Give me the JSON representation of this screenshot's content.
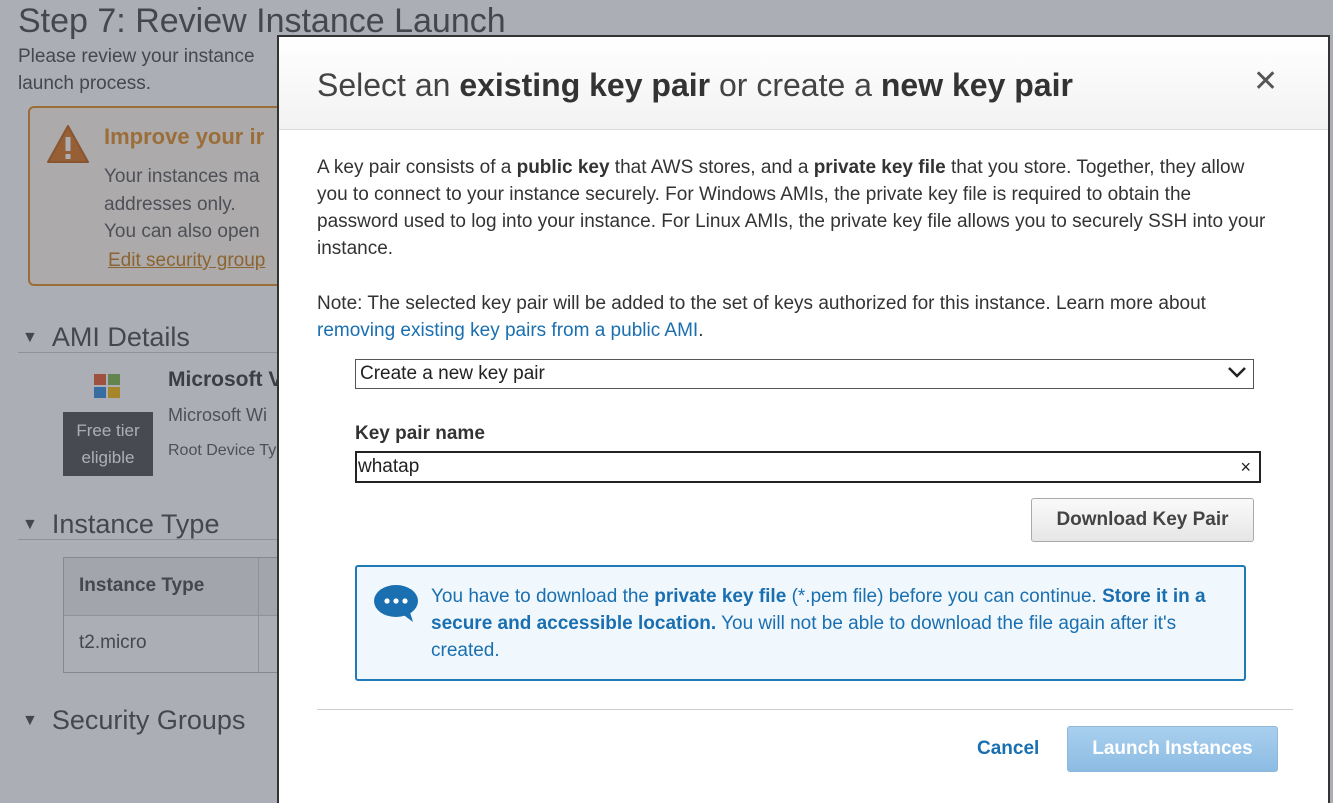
{
  "background": {
    "step_title": "Step 7: Review Instance Launch",
    "intro_line1": "Please review your instance",
    "intro_line2": "launch process.",
    "warning": {
      "title": "Improve your ir",
      "line1": "Your instances ma",
      "line2": "addresses only.",
      "line3": "You can also open",
      "link": "Edit security group"
    },
    "ami_section": "AMI Details",
    "ami": {
      "name": "Microsoft V",
      "subtitle": "Microsoft Wi",
      "root": "Root Device Ty",
      "free_tier_line1": "Free tier",
      "free_tier_line2": "eligible"
    },
    "instance_type_section": "Instance Type",
    "instance_table": {
      "header": "Instance Type",
      "value": "t2.micro"
    },
    "security_section": "Security Groups"
  },
  "modal": {
    "title_part1": "Select an ",
    "title_bold1": "existing key pair",
    "title_part2": " or create a ",
    "title_bold2": "new key pair",
    "close_glyph": "✕",
    "desc": {
      "t1": "A key pair consists of a ",
      "b1": "public key",
      "t2": " that AWS stores, and a ",
      "b2": "private key file",
      "t3": " that you store. Together, they allow you to connect to your instance securely. For Windows AMIs, the private key file is required to obtain the password used to log into your instance. For Linux AMIs, the private key file allows you to securely SSH into your instance."
    },
    "note": {
      "t1": "Note: The selected key pair will be added to the set of keys authorized for this instance. Learn more about ",
      "link": "removing existing key pairs from a public AMI",
      "t2": "."
    },
    "select_value": "Create a new key pair",
    "key_pair_label": "Key pair name",
    "key_pair_value": "whatap",
    "clear_glyph": "×",
    "download_button": "Download Key Pair",
    "info": {
      "t1": "You have to download the ",
      "b1": "private key file",
      "t2": " (*.pem file) before you can continue. ",
      "b2": "Store it in a secure and accessible location.",
      "t3": " You will not be able to download the file again after it's created."
    },
    "cancel_button": "Cancel",
    "launch_button": "Launch Instances"
  },
  "colors": {
    "link_blue": "#1a6fb0",
    "warning_orange": "#e08a1e",
    "launch_disabled": "#8cbce3"
  }
}
